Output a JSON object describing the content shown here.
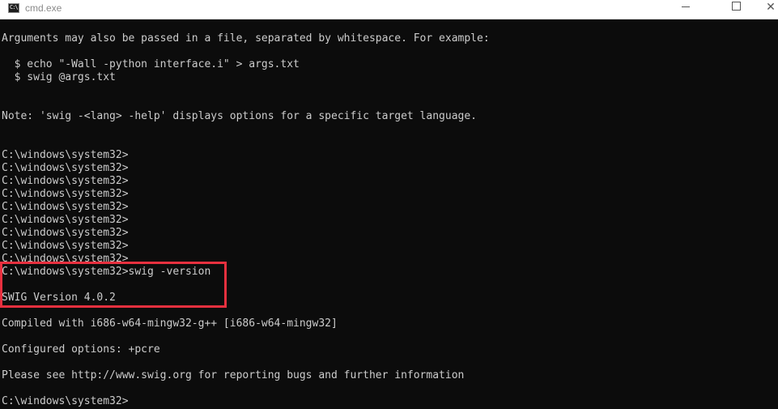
{
  "window": {
    "title": "cmd.exe",
    "icon": "console-icon",
    "icon_glyph": "C:\\",
    "controls": {
      "minimize": "minimize-icon",
      "maximize": "maximize-icon",
      "close_glyph": "✕"
    }
  },
  "console": {
    "lines": [
      "Arguments may also be passed in a file, separated by whitespace. For example:",
      "",
      "  $ echo \"-Wall -python interface.i\" > args.txt",
      "  $ swig @args.txt",
      "",
      "",
      "Note: 'swig -<lang> -help' displays options for a specific target language.",
      "",
      "",
      "C:\\windows\\system32>",
      "C:\\windows\\system32>",
      "C:\\windows\\system32>",
      "C:\\windows\\system32>",
      "C:\\windows\\system32>",
      "C:\\windows\\system32>",
      "C:\\windows\\system32>",
      "C:\\windows\\system32>",
      "C:\\windows\\system32>",
      "C:\\windows\\system32>swig -version",
      "",
      "SWIG Version 4.0.2",
      "",
      "Compiled with i686-w64-mingw32-g++ [i686-w64-mingw32]",
      "",
      "Configured options: +pcre",
      "",
      "Please see http://www.swig.org for reporting bugs and further information",
      "",
      "C:\\windows\\system32>"
    ]
  },
  "colors": {
    "console_background": "#0c0c0c",
    "console_text": "#cccccc",
    "highlight_border": "#e8303f"
  }
}
